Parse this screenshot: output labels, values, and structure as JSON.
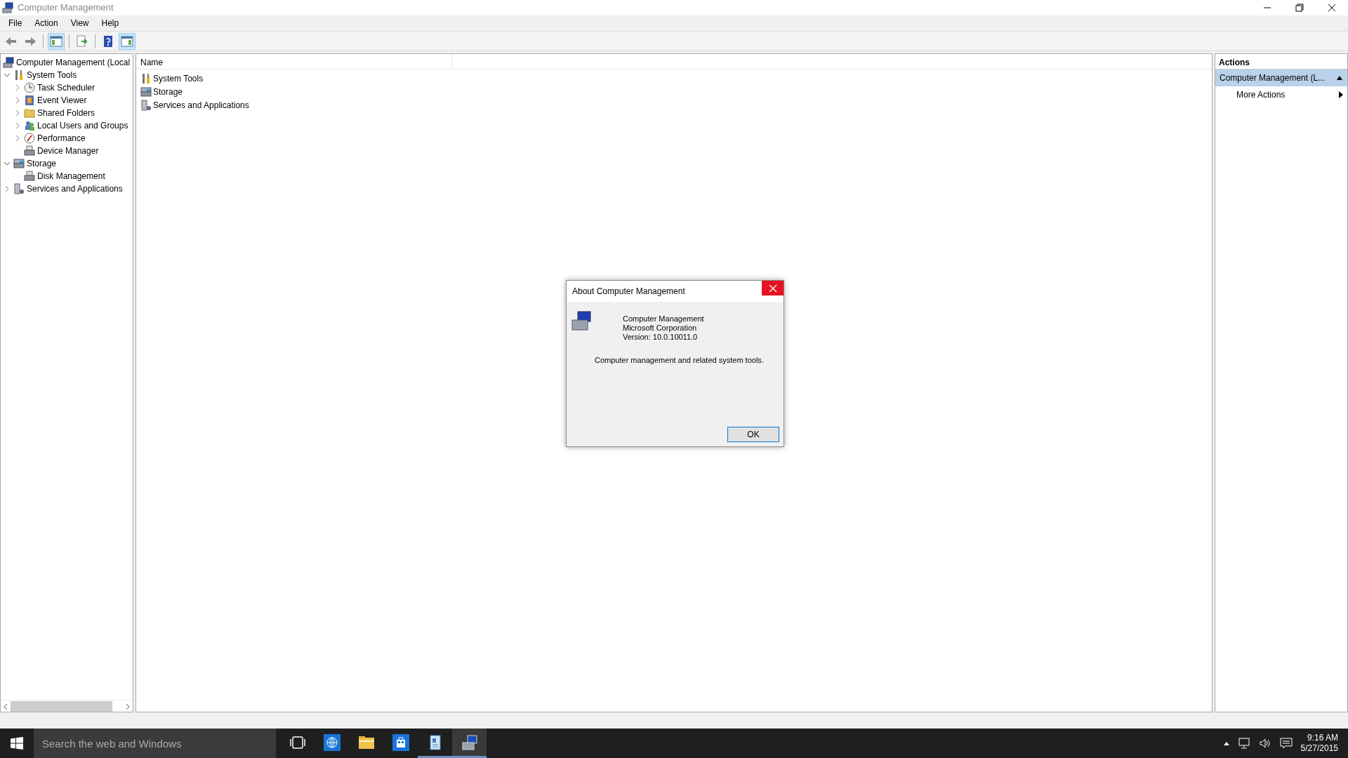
{
  "window": {
    "title": "Computer Management"
  },
  "menu": [
    "File",
    "Action",
    "View",
    "Help"
  ],
  "toolbar": [
    {
      "kind": "back"
    },
    {
      "kind": "forward"
    },
    {
      "kind": "sep"
    },
    {
      "kind": "tree-toggle",
      "pressed": true
    },
    {
      "kind": "sep"
    },
    {
      "kind": "export"
    },
    {
      "kind": "sep"
    },
    {
      "kind": "help"
    },
    {
      "kind": "pane-toggle",
      "pressed": true
    }
  ],
  "tree": [
    {
      "label": "Computer Management (Local",
      "kind": "computer",
      "children": [
        {
          "label": "System Tools",
          "kind": "tools",
          "expanded": true,
          "children": [
            {
              "label": "Task Scheduler",
              "kind": "clock",
              "expanded": false
            },
            {
              "label": "Event Viewer",
              "kind": "log",
              "expanded": false
            },
            {
              "label": "Shared Folders",
              "kind": "folder",
              "expanded": false
            },
            {
              "label": "Local Users and Groups",
              "kind": "users",
              "expanded": false
            },
            {
              "label": "Performance",
              "kind": "gauge",
              "expanded": false
            },
            {
              "label": "Device Manager",
              "kind": "device"
            }
          ]
        },
        {
          "label": "Storage",
          "kind": "storage",
          "expanded": true,
          "children": [
            {
              "label": "Disk Management",
              "kind": "device"
            }
          ]
        },
        {
          "label": "Services and Applications",
          "kind": "services",
          "expanded": false
        }
      ]
    }
  ],
  "list": {
    "columns": [
      "Name"
    ],
    "rows": [
      {
        "label": "System Tools",
        "kind": "tools"
      },
      {
        "label": "Storage",
        "kind": "storage"
      },
      {
        "label": "Services and Applications",
        "kind": "services"
      }
    ]
  },
  "actions": {
    "title": "Actions",
    "items": [
      {
        "label": "Computer Management (L...",
        "kind": "group",
        "selected": true
      },
      {
        "label": "More Actions",
        "kind": "submenu",
        "selected": false
      }
    ]
  },
  "dialog": {
    "title": "About Computer Management",
    "lines": [
      "Computer Management",
      "Microsoft Corporation",
      "Version: 10.0.10011.0"
    ],
    "description": "Computer management and related system tools.",
    "button": "OK"
  },
  "taskbar": {
    "search": {
      "placeholder": "Search the web and Windows"
    },
    "apps": [
      {
        "kind": "task-view",
        "running": false,
        "active": false
      },
      {
        "kind": "browser",
        "running": false,
        "active": false
      },
      {
        "kind": "folder",
        "running": false,
        "active": false
      },
      {
        "kind": "store",
        "running": false,
        "active": false
      },
      {
        "kind": "document",
        "running": true,
        "active": false
      },
      {
        "kind": "computer",
        "running": true,
        "active": true
      }
    ],
    "time": "9:16 AM",
    "date": "5/27/2015"
  }
}
